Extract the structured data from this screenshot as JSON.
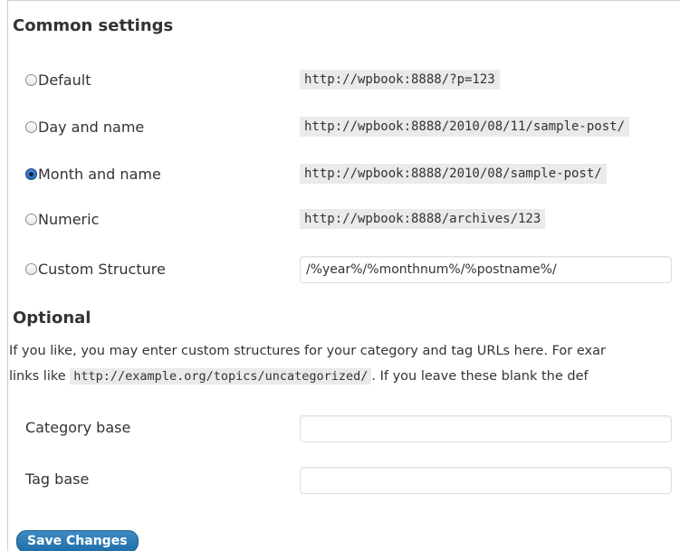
{
  "common": {
    "title": "Common settings",
    "options": [
      {
        "label": "Default",
        "example": "http://wpbook:8888/?p=123",
        "checked": false
      },
      {
        "label": "Day and name",
        "example": "http://wpbook:8888/2010/08/11/sample-post/",
        "checked": false
      },
      {
        "label": "Month and name",
        "example": "http://wpbook:8888/2010/08/sample-post/",
        "checked": true
      },
      {
        "label": "Numeric",
        "example": "http://wpbook:8888/archives/123",
        "checked": false
      },
      {
        "label": "Custom Structure",
        "value": "/%year%/%monthnum%/%postname%/",
        "checked": false
      }
    ]
  },
  "optional": {
    "title": "Optional",
    "description_line1": "If you like, you may enter custom structures for your category and tag URLs here. For exar",
    "description_line2_start": "links like",
    "description_example": "http://example.org/topics/uncategorized/",
    "description_line2_end": ". If you leave these blank the def",
    "category_base_label": "Category base",
    "category_base_value": "",
    "tag_base_label": "Tag base",
    "tag_base_value": ""
  },
  "save_button_label": "Save Changes"
}
